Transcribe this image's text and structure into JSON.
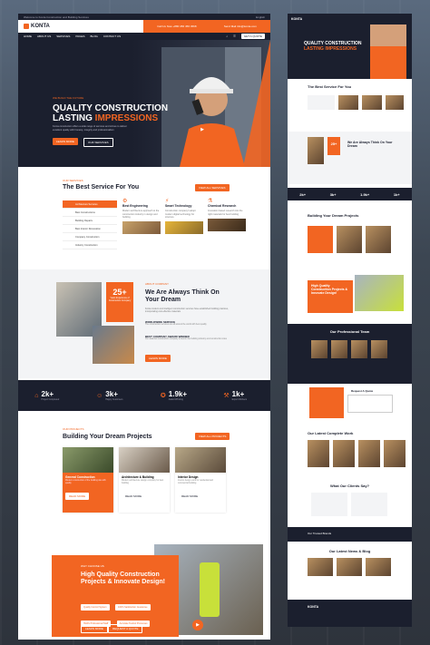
{
  "main": {
    "topbar": {
      "left": "Welcome to Konta Construction and Building Services",
      "right": "English"
    },
    "logo": "KONTA",
    "contact": {
      "phone_label": "Call Us Now",
      "phone": "+880 456 456 4568",
      "email_label": "Send Mail",
      "email": "info@konta.com",
      "quote_button": "GET A QUOTE"
    },
    "nav": [
      "HOME",
      "ABOUT US",
      "SERVICES",
      "PAGES",
      "BLOG",
      "CONTACT US"
    ],
    "hero": {
      "tag": "WE BUILD THE FUTURE",
      "title_line1": "QUALITY CONSTRUCTION",
      "title_line2a": "LASTING ",
      "title_line2b": "IMPRESSIONS",
      "desc": "Konta construction offers a wide range of services and strives to deliver excellent quality with honesty, integrity and professionalism",
      "btn_primary": "LEARN MORE",
      "btn_secondary": "OUR SERVICES"
    },
    "services": {
      "tag": "OUR SERVICES",
      "title": "The Best Service For You",
      "button": "VIEW ALL SERVICES",
      "list": [
        "Architecture Services",
        "Best Constructions",
        "Building Repairs",
        "Best Interior Renovation",
        "Company Construction",
        "Industry Construction"
      ],
      "cards": [
        {
          "title": "Best Engineering",
          "desc": "Modern architecture approach to the construction industry in design and building"
        },
        {
          "title": "Smart Technology",
          "desc": "Construction company's adopt modern digital technology for structure"
        },
        {
          "title": "Chemical Research",
          "desc": "Innovation based research into the right materials for best building"
        }
      ]
    },
    "about": {
      "badge_num": "25+",
      "badge_text": "Years Experience of Construction Company",
      "tag": "ABOUT COMPANY",
      "title": "We Are Always Think On Your Dream",
      "desc": "Konta modern and intelligent construction services have established building practices, incorporating cost-effective materials",
      "feature1_title": "WORLDWIDE SERVICE",
      "feature1_desc": "The construction services are all around the world with best quality",
      "feature2_title": "BEST COMPANY AWARD WINNER",
      "feature2_desc": "Our awarded construction company is best in the building industry and construction sites",
      "button": "LEARN MORE"
    },
    "stats": [
      {
        "num": "2k+",
        "label": "Project Completed"
      },
      {
        "num": "3k+",
        "label": "Happy Customers"
      },
      {
        "num": "1.9k+",
        "label": "Award Winning"
      },
      {
        "num": "1k+",
        "label": "Expert Workers"
      }
    ],
    "projects": {
      "tag": "OUR PROJECTS",
      "title": "Building Your Dream Projects",
      "button": "VIEW ALL PROJECTS",
      "cards": [
        {
          "title": "General Construction",
          "desc": "Modern construction of the building site with quality",
          "link": "READ MORE"
        },
        {
          "title": "Architecture & Building",
          "desc": "Modern architecture design company for best building",
          "link": "READ MORE"
        },
        {
          "title": "Interior Design",
          "desc": "Interior design work for residential and commercial building",
          "link": "READ MORE"
        }
      ]
    },
    "quality": {
      "tag": "WHY CHOOSE US",
      "title": "High Quality Construction Projects & Innovate Design!",
      "chips": [
        "Quality Control System",
        "100% Satisfaction Guarantee",
        "Highly Professional Staff",
        "Accurate Testing Processes"
      ],
      "button": "LEARN MORE",
      "button2": "REQUEST A QUOTE"
    }
  },
  "side": {
    "logo": "KONTA",
    "hero_title1": "QUALITY CONSTRUCTION",
    "hero_title2": "LASTING IMPRESSIONS",
    "services_title": "The Best Service For You",
    "about_title": "We Are Always Think On Your Dream",
    "about_num": "25+",
    "stats": [
      "2k+",
      "3k+",
      "1.9k+",
      "1k+"
    ],
    "projects_title": "Building Your Dream Projects",
    "quality_title": "High Quality Construction Projects & Innovate Design!",
    "team_title": "Our Professional Team",
    "quote_title": "Request A Quote",
    "work_title": "Our Latest Complete Work",
    "testimonial_title": "What Our Clients Say?",
    "brands_title": "Our Trusted Brands",
    "news_title": "Our Latest News & Blog"
  },
  "colors": {
    "accent": "#f26522",
    "dark": "#1b1f2e"
  }
}
